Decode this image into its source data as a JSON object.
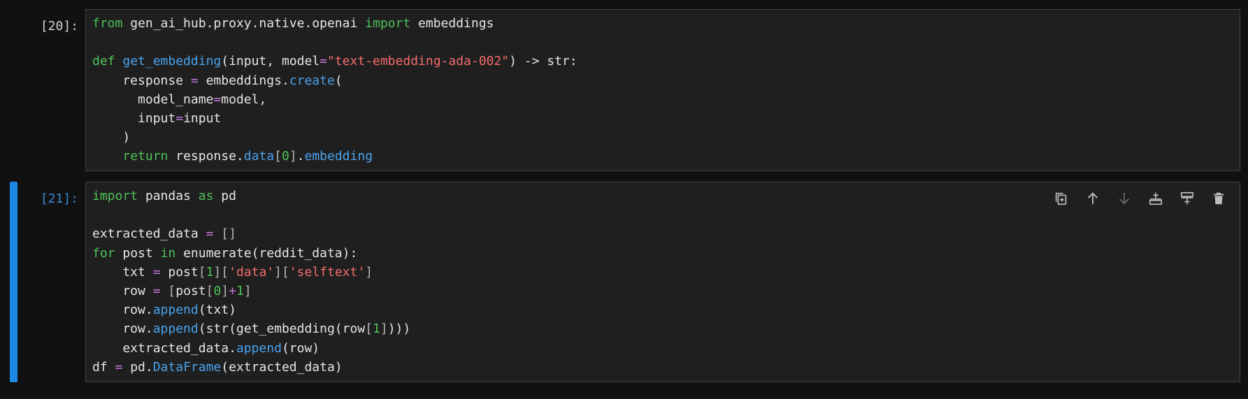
{
  "cells": [
    {
      "prompt": "[20]:",
      "active": false,
      "lines": [
        [
          [
            "kw",
            "from"
          ],
          [
            "t",
            " gen_ai_hub.proxy.native.openai "
          ],
          [
            "kw",
            "import"
          ],
          [
            "t",
            " embeddings"
          ]
        ],
        [],
        [
          [
            "kw",
            "def"
          ],
          [
            "t",
            " "
          ],
          [
            "fn",
            "get_embedding"
          ],
          [
            "t",
            "(input, model"
          ],
          [
            "op",
            "="
          ],
          [
            "str",
            "\"text-embedding-ada-002\""
          ],
          [
            "t",
            ") -> str:"
          ]
        ],
        [
          [
            "t",
            "    response "
          ],
          [
            "op",
            "="
          ],
          [
            "t",
            " embeddings."
          ],
          [
            "fn",
            "create"
          ],
          [
            "t",
            "("
          ]
        ],
        [
          [
            "t",
            "      model_name"
          ],
          [
            "op",
            "="
          ],
          [
            "t",
            "model,"
          ]
        ],
        [
          [
            "t",
            "      input"
          ],
          [
            "op",
            "="
          ],
          [
            "t",
            "input"
          ]
        ],
        [
          [
            "t",
            "    )"
          ]
        ],
        [
          [
            "t",
            "    "
          ],
          [
            "kw",
            "return"
          ],
          [
            "t",
            " response."
          ],
          [
            "fn",
            "data"
          ],
          [
            "br",
            "["
          ],
          [
            "num",
            "0"
          ],
          [
            "br",
            "]"
          ],
          [
            "t",
            "."
          ],
          [
            "fn",
            "embedding"
          ]
        ]
      ]
    },
    {
      "prompt": "[21]:",
      "active": true,
      "lines": [
        [
          [
            "kw",
            "import"
          ],
          [
            "t",
            " pandas "
          ],
          [
            "kw",
            "as"
          ],
          [
            "t",
            " pd"
          ]
        ],
        [],
        [
          [
            "t",
            "extracted_data "
          ],
          [
            "op",
            "="
          ],
          [
            "t",
            " "
          ],
          [
            "br",
            "[]"
          ]
        ],
        [
          [
            "kw",
            "for"
          ],
          [
            "t",
            " post "
          ],
          [
            "kw",
            "in"
          ],
          [
            "t",
            " enumerate(reddit_data):"
          ]
        ],
        [
          [
            "t",
            "    txt "
          ],
          [
            "op",
            "="
          ],
          [
            "t",
            " post"
          ],
          [
            "br",
            "["
          ],
          [
            "num",
            "1"
          ],
          [
            "br",
            "]["
          ],
          [
            "str",
            "'data'"
          ],
          [
            "br",
            "]["
          ],
          [
            "str",
            "'selftext'"
          ],
          [
            "br",
            "]"
          ]
        ],
        [
          [
            "t",
            "    row "
          ],
          [
            "op",
            "="
          ],
          [
            "t",
            " "
          ],
          [
            "br",
            "["
          ],
          [
            "t",
            "post"
          ],
          [
            "br",
            "["
          ],
          [
            "num",
            "0"
          ],
          [
            "br",
            "]"
          ],
          [
            "op",
            "+"
          ],
          [
            "num",
            "1"
          ],
          [
            "br",
            "]"
          ]
        ],
        [
          [
            "t",
            "    row."
          ],
          [
            "fn",
            "append"
          ],
          [
            "t",
            "(txt)"
          ]
        ],
        [
          [
            "t",
            "    row."
          ],
          [
            "fn",
            "append"
          ],
          [
            "t",
            "(str(get_embedding(row"
          ],
          [
            "br",
            "["
          ],
          [
            "num",
            "1"
          ],
          [
            "br",
            "]"
          ],
          [
            "t",
            ")))"
          ]
        ],
        [
          [
            "t",
            "    extracted_data."
          ],
          [
            "fn",
            "append"
          ],
          [
            "t",
            "(row)"
          ]
        ],
        [
          [
            "t",
            "df "
          ],
          [
            "op",
            "="
          ],
          [
            "t",
            " pd."
          ],
          [
            "fn",
            "DataFrame"
          ],
          [
            "t",
            "(extracted_data)"
          ]
        ]
      ]
    }
  ],
  "toolbar": {
    "buttons": [
      {
        "name": "duplicate-cell-button",
        "icon": "duplicate-icon",
        "enabled": true
      },
      {
        "name": "move-up-button",
        "icon": "arrow-up-icon",
        "enabled": true
      },
      {
        "name": "move-down-button",
        "icon": "arrow-down-icon",
        "enabled": false
      },
      {
        "name": "insert-above-button",
        "icon": "insert-above-icon",
        "enabled": true
      },
      {
        "name": "insert-below-button",
        "icon": "insert-below-icon",
        "enabled": true
      },
      {
        "name": "delete-cell-button",
        "icon": "trash-icon",
        "enabled": true
      }
    ]
  },
  "colors": {
    "background": "#111111",
    "editor_background": "#1f1f1f",
    "editor_border": "#444444",
    "active_bar": "#1e88e5",
    "keyword": "#4ec259",
    "function": "#4aa3ee",
    "string": "#f36c6c",
    "operator": "#c678dd",
    "text": "#e6e6e6"
  }
}
